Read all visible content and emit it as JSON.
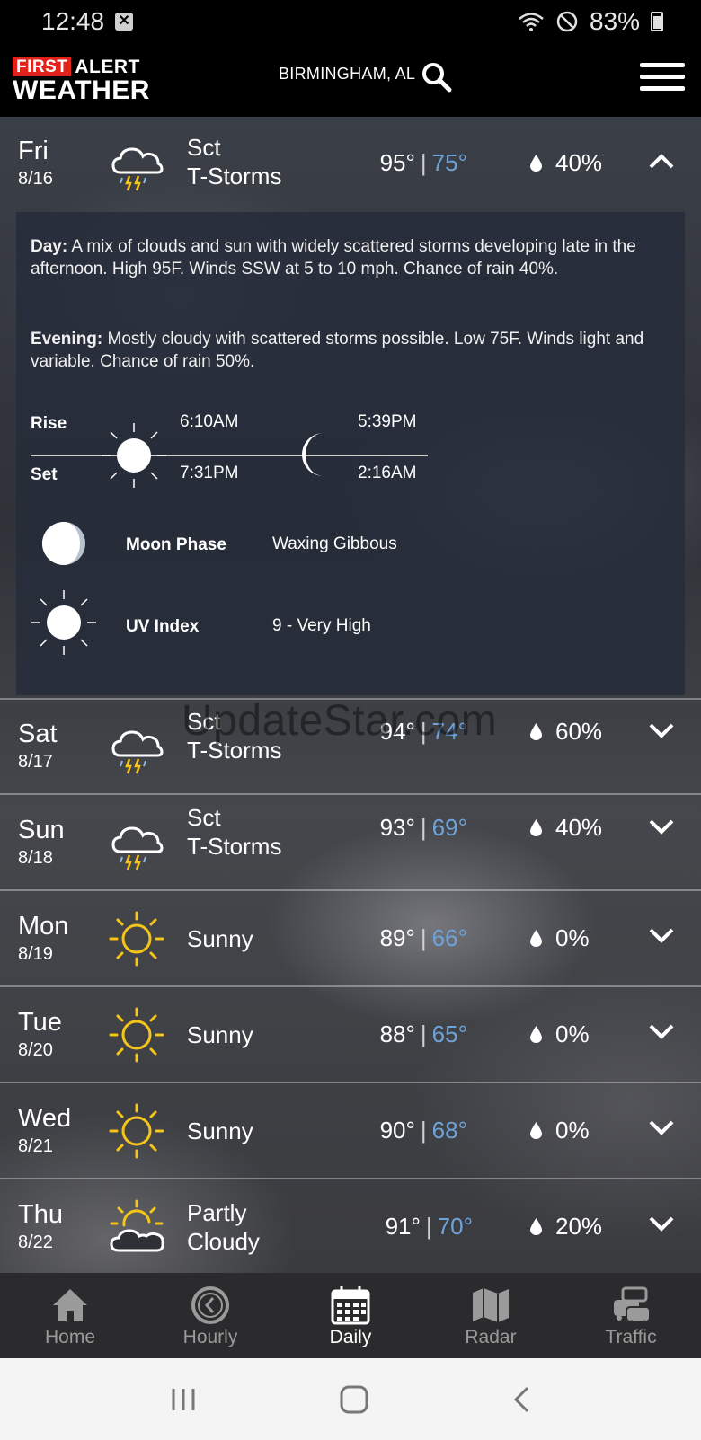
{
  "status_bar": {
    "time": "12:48",
    "battery": "83%"
  },
  "header": {
    "logo_first": "FIRST",
    "logo_alert": "ALERT",
    "logo_weather": "WEATHER",
    "location": "BIRMINGHAM, AL"
  },
  "expanded": {
    "day_label": "Day:",
    "day_text": "A mix of clouds and sun with widely scattered storms developing late in the afternoon. High 95F. Winds SSW at 5 to 10 mph. Chance of rain 40%.",
    "evening_label": "Evening:",
    "evening_text": "Mostly cloudy with scattered storms possible. Low 75F. Winds light and variable. Chance of rain 50%.",
    "rise_label": "Rise",
    "set_label": "Set",
    "sunrise": "6:10AM",
    "sunset": "7:31PM",
    "moonrise": "5:39PM",
    "moonset": "2:16AM",
    "moon_phase_label": "Moon Phase",
    "moon_phase_value": "Waxing Gibbous",
    "uv_label": "UV Index",
    "uv_value": "9 - Very High"
  },
  "days": [
    {
      "day": "Fri",
      "date": "8/16",
      "cond1": "Sct",
      "cond2": "T-Storms",
      "hi": "95°",
      "lo": "75°",
      "precip": "40%",
      "icon": "thunderstorm-icon"
    },
    {
      "day": "Sat",
      "date": "8/17",
      "cond1": "Sct",
      "cond2": "T-Storms",
      "hi": "94°",
      "lo": "74°",
      "precip": "60%",
      "icon": "thunderstorm-icon"
    },
    {
      "day": "Sun",
      "date": "8/18",
      "cond1": "Sct",
      "cond2": "T-Storms",
      "hi": "93°",
      "lo": "69°",
      "precip": "40%",
      "icon": "thunderstorm-icon"
    },
    {
      "day": "Mon",
      "date": "8/19",
      "cond1": "Sunny",
      "cond2": "",
      "hi": "89°",
      "lo": "66°",
      "precip": "0%",
      "icon": "sun-icon"
    },
    {
      "day": "Tue",
      "date": "8/20",
      "cond1": "Sunny",
      "cond2": "",
      "hi": "88°",
      "lo": "65°",
      "precip": "0%",
      "icon": "sun-icon"
    },
    {
      "day": "Wed",
      "date": "8/21",
      "cond1": "Sunny",
      "cond2": "",
      "hi": "90°",
      "lo": "68°",
      "precip": "0%",
      "icon": "sun-icon"
    },
    {
      "day": "Thu",
      "date": "8/22",
      "cond1": "Partly",
      "cond2": "Cloudy",
      "hi": "91°",
      "lo": "70°",
      "precip": "20%",
      "icon": "partly-cloudy-icon"
    }
  ],
  "watermark": "UpdateStar.com",
  "nav": [
    {
      "label": "Home",
      "icon": "home-icon"
    },
    {
      "label": "Hourly",
      "icon": "clock-icon"
    },
    {
      "label": "Daily",
      "icon": "calendar-icon"
    },
    {
      "label": "Radar",
      "icon": "map-icon"
    },
    {
      "label": "Traffic",
      "icon": "traffic-icon"
    }
  ],
  "colors": {
    "low_temp": "#6fa3d8",
    "sun_yellow": "#f5c518",
    "header_bg": "#000000",
    "nav_bg": "#2b2b2d"
  }
}
